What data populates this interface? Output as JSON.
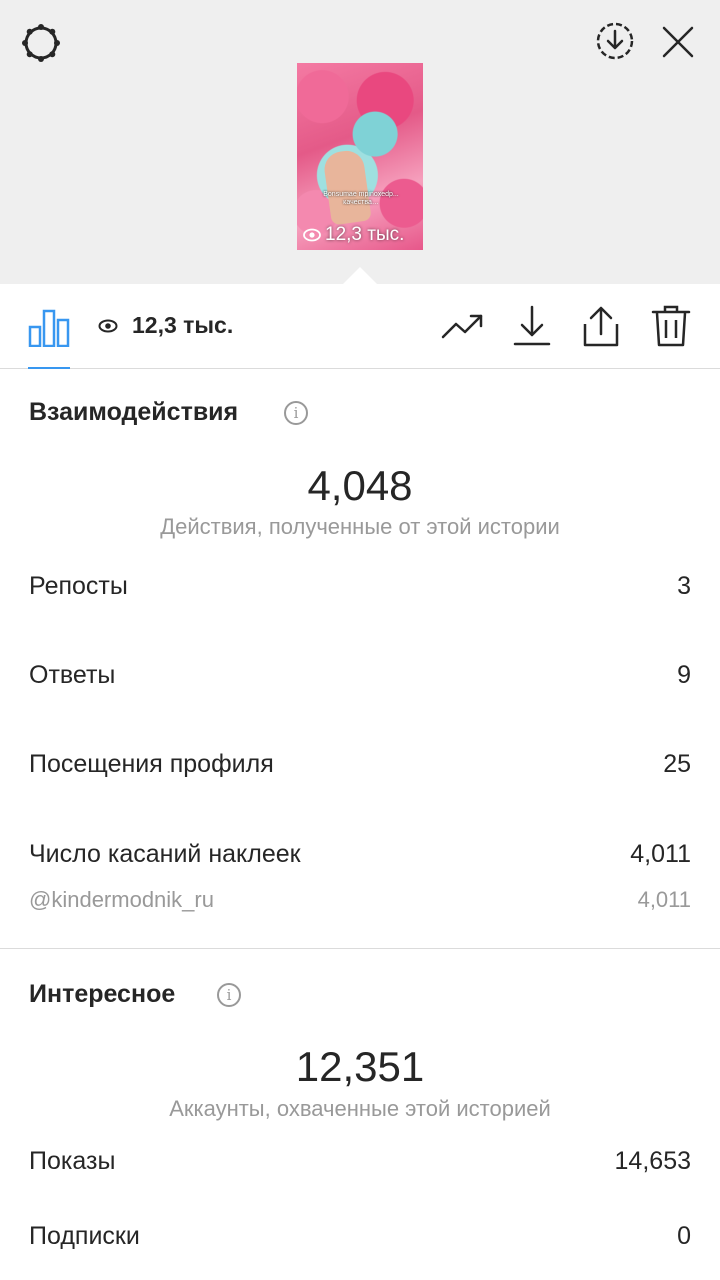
{
  "header": {
    "settings_icon": "settings-gear-icon",
    "download_circle_icon": "download-circle-icon",
    "close_icon": "close-icon"
  },
  "story_preview": {
    "caption": "Bonsumae mpinoxedp... качества…",
    "views": "12,3 тыс."
  },
  "toolbar": {
    "insights_icon": "bar-chart-icon",
    "views_icon": "eye-icon",
    "views": "12,3 тыс.",
    "promote_icon": "trend-up-icon",
    "save_icon": "download-icon",
    "share_icon": "share-icon",
    "delete_icon": "trash-icon"
  },
  "interactions": {
    "title": "Взаимодействия",
    "total": "4,048",
    "caption": "Действия, полученные от этой истории",
    "rows": [
      {
        "label": "Репосты",
        "value": "3"
      },
      {
        "label": "Ответы",
        "value": "9"
      },
      {
        "label": "Посещения профиля",
        "value": "25"
      },
      {
        "label": "Число касаний наклеек",
        "value": "4,011"
      }
    ],
    "sticker": {
      "label": "@kindermodnik_ru",
      "value": "4,011"
    }
  },
  "discovery": {
    "title": "Интересное",
    "total": "12,351",
    "caption": "Аккаунты, охваченные этой историей",
    "rows": [
      {
        "label": "Показы",
        "value": "14,653"
      },
      {
        "label": "Подписки",
        "value": "0"
      }
    ]
  },
  "colors": {
    "accent": "#3897f0",
    "text": "#262626",
    "muted": "#999999",
    "top_bg": "#efefef"
  }
}
